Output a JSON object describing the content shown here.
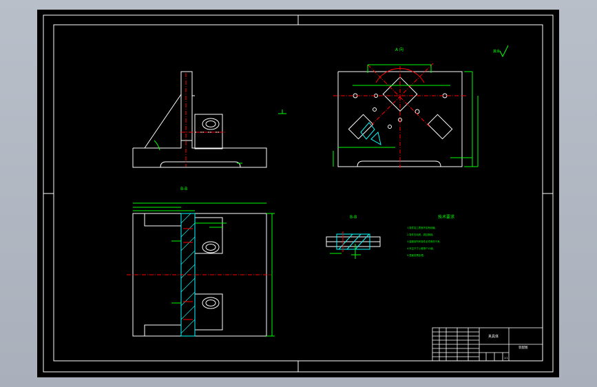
{
  "colors": {
    "background": "#aeb5bf",
    "sheet": "#000000",
    "frame": "#ffffff",
    "dimension": "#00ff00",
    "center_line": "#ff0000",
    "section_hatch": "#00ffff",
    "title_table": "#ffffff"
  },
  "views": {
    "top_right_label": "A 向",
    "section_label": "B-B",
    "small_section_label": "B-B",
    "roughness_label": "其余"
  },
  "tech_requirements": {
    "title": "技术要求",
    "items": [
      "1.零件加工表面不应有划痕。",
      "2.零件去毛刺，锐边倒钝。",
      "3.装配前所有零件必须清洗干净。",
      "4.未注尺寸公差按IT12级。",
      "5.表面发黑处理。"
    ]
  },
  "title_block": {
    "drawing_name": "夹具体",
    "company": "装配图",
    "scale": "1:1"
  },
  "icons": {
    "roughness": "roughness-symbol-icon"
  }
}
